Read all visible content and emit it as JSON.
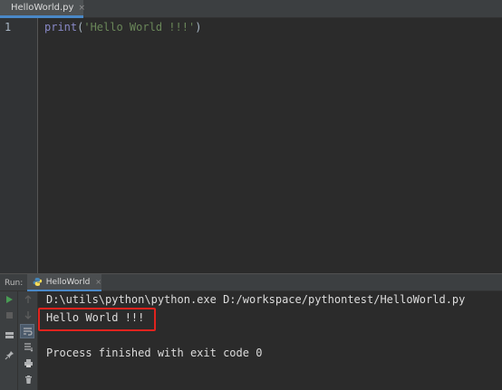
{
  "editor": {
    "tab": {
      "label": "HelloWorld.py",
      "close_glyph": "×"
    },
    "line_number": "1",
    "code": {
      "function": "print",
      "open_paren": "(",
      "string": "'Hello World !!!'",
      "close_paren": ")"
    }
  },
  "run_panel": {
    "label": "Run:",
    "tab": {
      "label": "HelloWorld",
      "close_glyph": "×"
    },
    "console": {
      "command": "D:\\utils\\python\\python.exe D:/workspace/pythontest/HelloWorld.py",
      "output": "Hello World !!!",
      "exit_message": "Process finished with exit code 0"
    },
    "toolbar_icons": [
      "run-icon",
      "stop-icon",
      "up-arrow-icon",
      "down-arrow-icon",
      "layout-icon",
      "soft-wrap-icon",
      "sort-icon",
      "pin-icon",
      "print-icon",
      "trash-icon"
    ]
  },
  "colors": {
    "background": "#2b2b2b",
    "highlight_border": "#e0231e",
    "string": "#6a8759",
    "builtin": "#8888c6",
    "accent": "#4a88c7"
  }
}
